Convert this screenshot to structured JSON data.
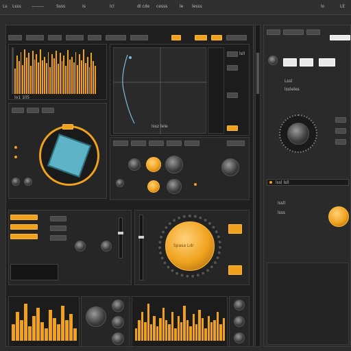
{
  "menubar": {
    "items": [
      "Ls",
      "Lsss",
      "———",
      "Ssss",
      "Is",
      "lcl",
      "dl cde",
      "cesss",
      "le",
      "lesss",
      "lo",
      "LE"
    ]
  },
  "analyzer": {
    "readout": "lo1 1ll5"
  },
  "scope": {
    "readout": "lssz lele",
    "side_label": "lsll"
  },
  "big_knob": {
    "label": "Spasa Ldr"
  },
  "right_panel": {
    "labels": [
      "Lssl",
      "lssleles",
      "lssll",
      "lsss"
    ]
  },
  "status": {
    "label": "lssl lsll"
  },
  "colors": {
    "accent": "#f0a21e",
    "panel": "#262626",
    "background": "#2b2b2b"
  },
  "spectrum_main": {
    "bins": [
      0.55,
      0.82,
      0.7,
      0.9,
      0.62,
      0.95,
      0.78,
      0.88,
      0.6,
      0.92,
      0.74,
      0.85,
      0.68,
      0.96,
      0.72,
      0.8,
      0.66,
      0.9,
      0.58,
      0.86,
      0.76,
      0.93,
      0.64,
      0.88,
      0.7,
      0.82,
      0.6,
      0.94,
      0.74,
      0.79,
      0.67,
      0.9,
      0.62,
      0.85,
      0.72,
      0.95,
      0.66,
      0.8,
      0.58,
      0.88,
      0.7,
      0.6
    ]
  },
  "spectrum_bottom_left": {
    "bins": [
      0.4,
      0.7,
      0.5,
      0.9,
      0.35,
      0.6,
      0.8,
      0.45,
      0.3,
      0.75,
      0.55,
      0.4,
      0.85,
      0.5,
      0.65,
      0.3
    ]
  },
  "spectrum_bottom_mid": {
    "bins": [
      0.3,
      0.5,
      0.7,
      0.45,
      0.9,
      0.4,
      0.6,
      0.35,
      0.55,
      0.8,
      0.5,
      0.4,
      0.7,
      0.3,
      0.6,
      0.45,
      0.85,
      0.5,
      0.35,
      0.65,
      0.4,
      0.75,
      0.55,
      0.3,
      0.6,
      0.45,
      0.5,
      0.7,
      0.4,
      0.55
    ]
  }
}
